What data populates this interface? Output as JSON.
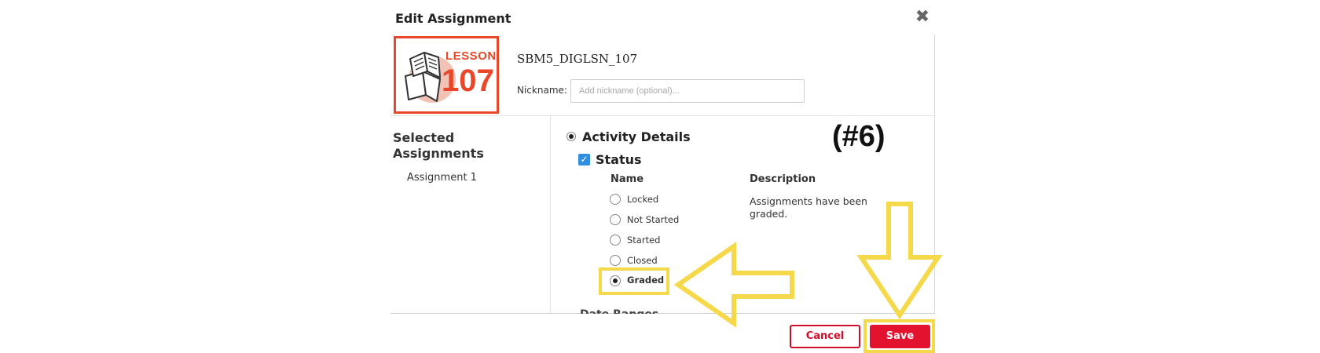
{
  "dialog": {
    "title": "Edit Assignment",
    "close_glyph": "✖"
  },
  "header": {
    "thumbnail_word": "LESSON",
    "thumbnail_number": "107",
    "assignment_code": "SBM5_DIGLSN_107",
    "nickname_label": "Nickname:",
    "nickname_placeholder": "Add nickname (optional)...",
    "nickname_value": ""
  },
  "sidebar": {
    "title": "Selected Assignments",
    "items": [
      "Assignment 1"
    ]
  },
  "activity": {
    "label": "Activity Details",
    "selected": true,
    "status": {
      "label": "Status",
      "checked": true,
      "column_name": "Name",
      "column_description": "Description",
      "options": [
        {
          "label": "Locked",
          "selected": false
        },
        {
          "label": "Not Started",
          "selected": false
        },
        {
          "label": "Started",
          "selected": false
        },
        {
          "label": "Closed",
          "selected": false
        },
        {
          "label": "Graded",
          "selected": true
        }
      ],
      "description": "Assignments have been graded."
    },
    "cutoff_heading": "Date Ranges"
  },
  "footer": {
    "cancel_label": "Cancel",
    "save_label": "Save"
  },
  "annotation": {
    "step_label": "(#6)",
    "highlight_color": "#f5d94b"
  },
  "colors": {
    "accent_red": "#e3122f",
    "lesson_orange": "#e8472a",
    "checkbox_blue": "#2f8ee0"
  }
}
